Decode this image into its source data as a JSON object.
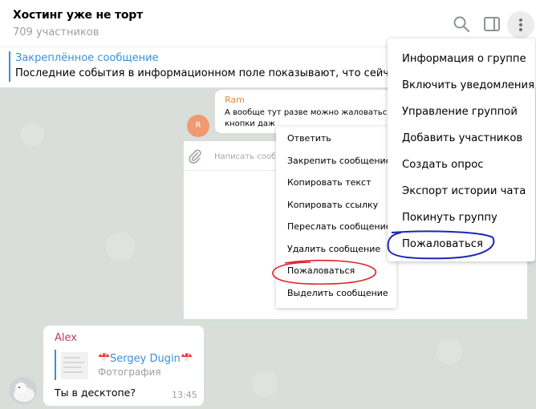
{
  "header": {
    "title": "Хостинг уже не торт",
    "subtitle": "709 участников"
  },
  "pinned": {
    "title": "Закреплённое сообщение",
    "text": "Последние события в информационном поле показывают, что сейчас как"
  },
  "main_menu": {
    "items": [
      "Информация о группе",
      "Включить уведомления",
      "Управление группой",
      "Добавить участников",
      "Создать опрос",
      "Экспорт истории чата",
      "Покинуть группу",
      "Пожаловаться"
    ]
  },
  "inner_screenshot": {
    "sender": "Ram",
    "message": "А вообще тут разве можно жаловаться\nкнопки даж",
    "avatar_letter": "R",
    "input_placeholder": "Написать сообщение",
    "context_menu": [
      "Ответить",
      "Закрепить сообщение",
      "Копировать текст",
      "Копировать ссылку",
      "Переслать сообщение",
      "Удалить сообщение",
      "Пожаловаться",
      "Выделить сообщение"
    ]
  },
  "message": {
    "sender": "Alex",
    "forward_name": "Sergey Dugin",
    "forward_type": "Фотография",
    "text": "Ты в десктопе?",
    "time": "13:45"
  },
  "colors": {
    "accent": "#3a8fd8",
    "annotation_red": "#e0202a",
    "annotation_blue": "#1a27b8",
    "chat_background": "#d9dedb"
  }
}
